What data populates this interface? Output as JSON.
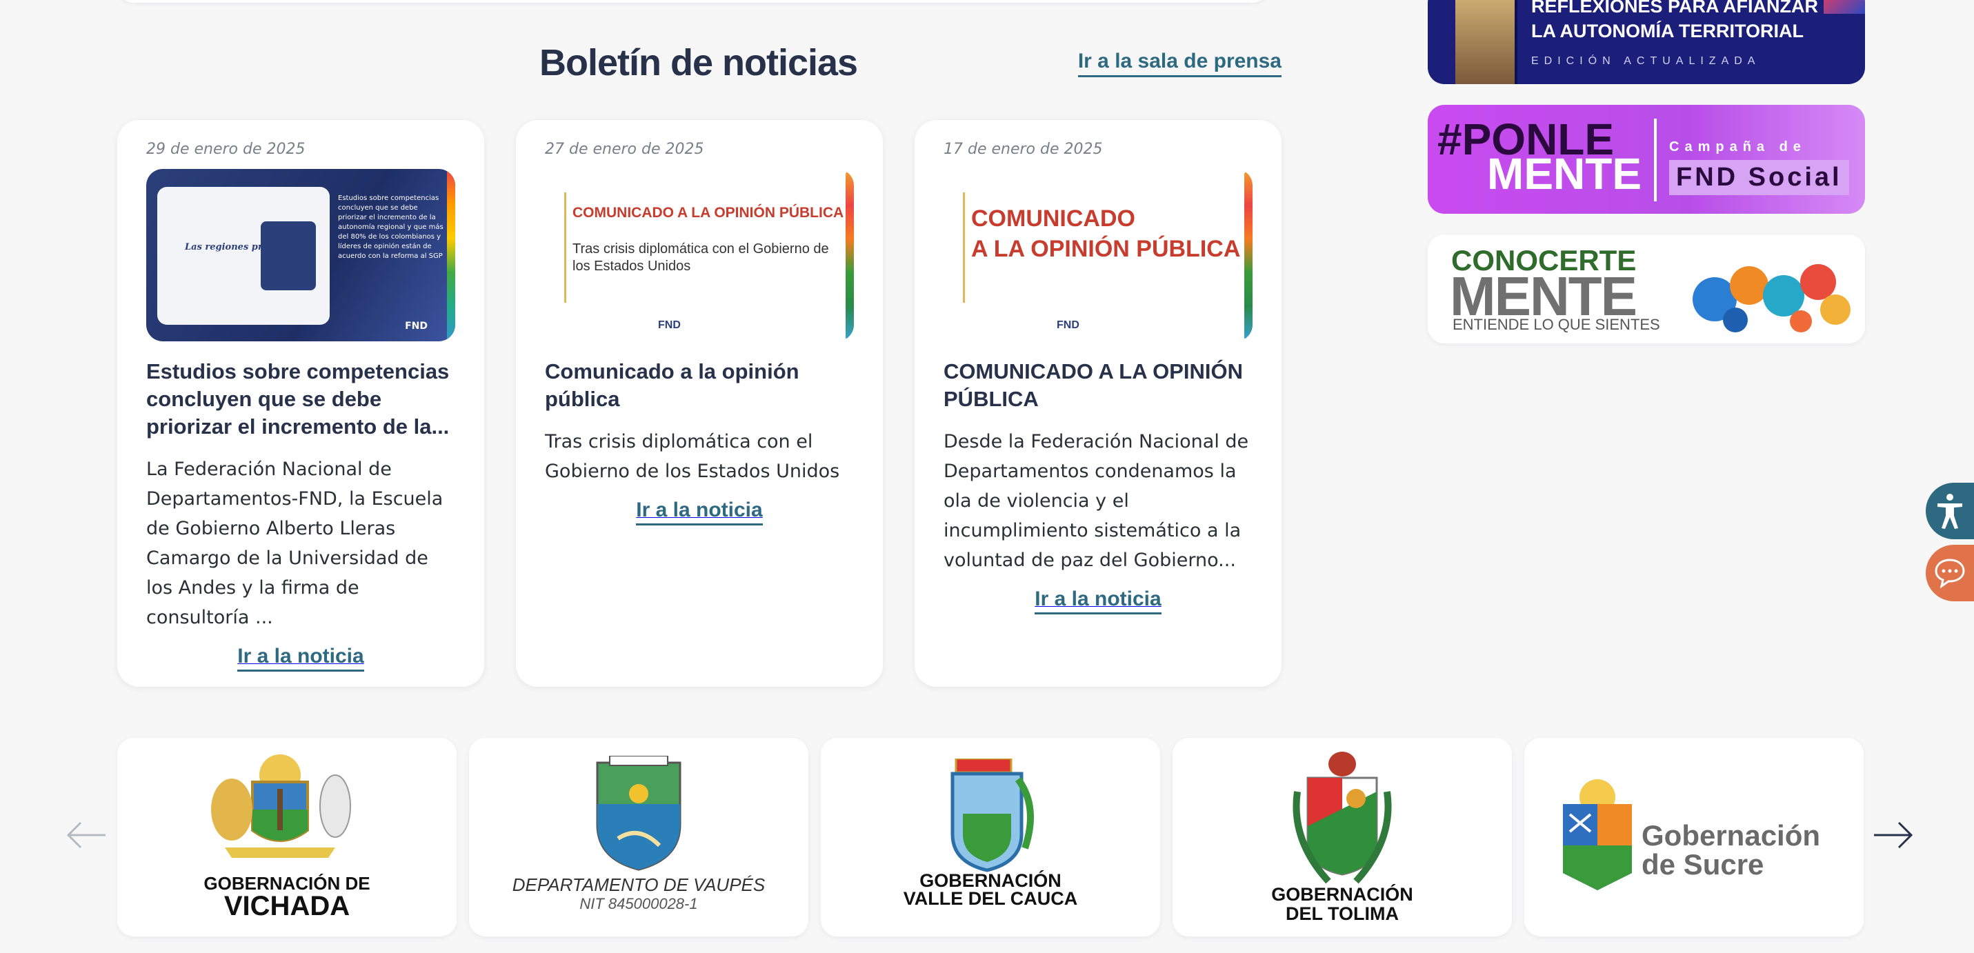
{
  "news": {
    "title": "Boletín de noticias",
    "press_link": "Ir a la sala de prensa",
    "read_more": "Ir a la noticia",
    "cards": [
      {
        "date": "29 de enero de 2025",
        "title": "Estudios sobre competencias concluyen que se debe priorizar el incremento de la...",
        "summary": "La Federación Nacional de Departamentos-FND, la Escuela de Gobierno Alberto Lleras Camargo de la Universidad de los Andes y la firma de consultoría ...",
        "image": {
          "left_title": "Las regiones proponen",
          "text": "Estudios sobre competencias concluyen que se debe priorizar el incremento de la autonomía regional y que más del 80% de los colombianos y líderes de opinión están de acuerdo con la reforma al SGP",
          "brand": "FND"
        }
      },
      {
        "date": "27 de enero de 2025",
        "title": "Comunicado a la opinión pública",
        "summary": "Tras crisis diplomática con el Gobierno de los Estados Unidos",
        "image": {
          "heading": "COMUNICADO A LA OPINIÓN PÚBLICA",
          "sub": "Tras crisis diplomática con el Gobierno de los Estados Unidos",
          "brand": "FND"
        }
      },
      {
        "date": "17 de enero de 2025",
        "title": "COMUNICADO A LA OPINIÓN PÚBLICA",
        "summary": "Desde la Federación Nacional de Departamentos condenamos la ola de violencia y el incumplimiento sistemático a la voluntad de paz del Gobierno...",
        "image": {
          "heading_line1": "COMUNICADO",
          "heading_line2": "A LA OPINIÓN PÚBLICA",
          "brand": "FND"
        }
      }
    ]
  },
  "banners": {
    "reflexiones": {
      "line1": "REFLEXIONES PARA AFIANZAR",
      "line2": "LA AUTONOMÍA TERRITORIAL",
      "line3": "EDICIÓN ACTUALIZADA"
    },
    "ponle": {
      "hash": "#PONLE",
      "mente": "MENTE",
      "campaign": "Campaña de",
      "social": "FND Social"
    },
    "conoce": {
      "line1": "CONOCERTE",
      "line2": "MENTE",
      "line3": "ENTIENDE LO QUE SIENTES"
    }
  },
  "carousel": {
    "logos": [
      {
        "line1": "GOBERNACIÓN DE",
        "line2": "VICHADA"
      },
      {
        "line1": "DEPARTAMENTO DE VAUPÉS",
        "line2": "NIT 845000028-1"
      },
      {
        "line1": "GOBERNACIÓN",
        "line2": "VALLE DEL CAUCA"
      },
      {
        "line1": "GOBERNACIÓN",
        "line2": "DEL TOLIMA"
      },
      {
        "line1": "Gobernación",
        "line2": "de Sucre"
      }
    ]
  },
  "colors": {
    "accent": "#2d6a82",
    "title": "#27324a",
    "chat": "#e1734a"
  }
}
